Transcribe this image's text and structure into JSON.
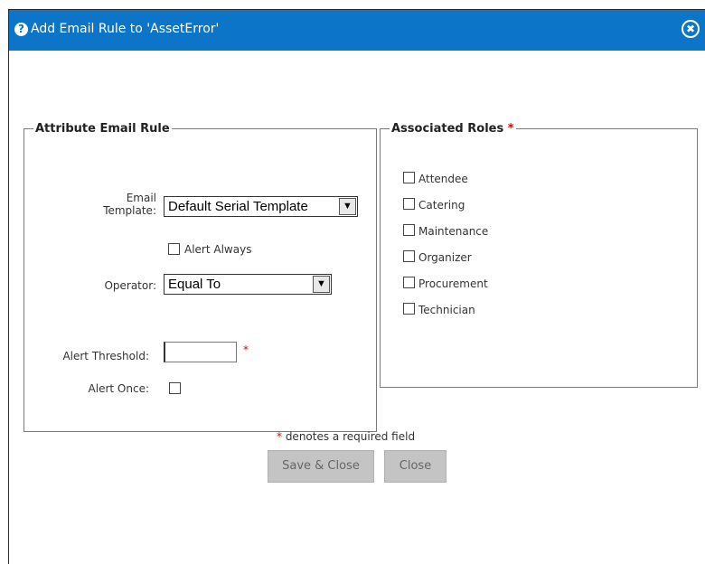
{
  "dialog": {
    "help_glyph": "?",
    "title": "Add Email Rule to 'AssetError'",
    "close_glyph": "✖"
  },
  "attribute_rule": {
    "legend": "Attribute Email Rule",
    "email_template_label_line1": "Email",
    "email_template_label_line2": "Template:",
    "email_template_value": "Default Serial Template",
    "alert_always_label": "Alert Always",
    "operator_label": "Operator:",
    "operator_value": "Equal To",
    "alert_threshold_label": "Alert Threshold:",
    "alert_threshold_value": "",
    "required_marker": "*",
    "alert_once_label": "Alert Once:"
  },
  "associated_roles": {
    "legend": "Associated Roles",
    "required_marker": "*",
    "roles": [
      {
        "label": "Attendee",
        "checked": false
      },
      {
        "label": "Catering",
        "checked": false
      },
      {
        "label": "Maintenance",
        "checked": false
      },
      {
        "label": "Organizer",
        "checked": false
      },
      {
        "label": "Procurement",
        "checked": false
      },
      {
        "label": "Technician",
        "checked": false
      }
    ]
  },
  "footer": {
    "required_marker": "*",
    "required_note": " denotes a required field",
    "save_close_label": "Save & Close",
    "close_label": "Close"
  },
  "icons": {
    "dropdown_arrow": "chevron-down-icon",
    "help": "help-icon",
    "close": "close-icon"
  },
  "colors": {
    "title_bar": "#0d75c8",
    "required": "#e00000",
    "button_bg": "#c4c4c4"
  }
}
